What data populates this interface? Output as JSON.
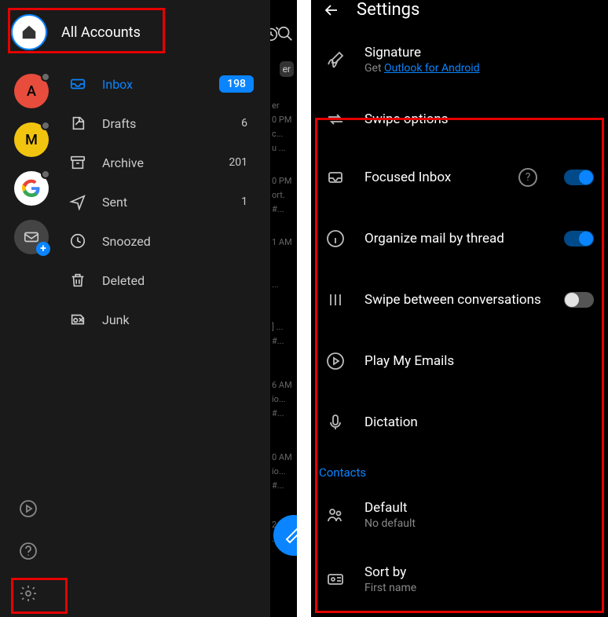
{
  "left": {
    "title": "All Accounts",
    "accounts": [
      {
        "letter": "A",
        "class": "badge-red"
      },
      {
        "letter": "M",
        "class": "badge-yellow"
      },
      {
        "letter": "G",
        "class": "badge-white",
        "google": true
      },
      {
        "letter": "",
        "class": "badge-gray",
        "mail": true,
        "add": true
      }
    ],
    "folders": [
      {
        "name": "Inbox",
        "count": "198",
        "active": true,
        "badge": true,
        "icon": "inbox"
      },
      {
        "name": "Drafts",
        "count": "6",
        "icon": "drafts"
      },
      {
        "name": "Archive",
        "count": "201",
        "icon": "archive"
      },
      {
        "name": "Sent",
        "count": "1",
        "icon": "sent"
      },
      {
        "name": "Snoozed",
        "count": "",
        "icon": "snoozed"
      },
      {
        "name": "Deleted",
        "count": "",
        "icon": "deleted"
      },
      {
        "name": "Junk",
        "count": "",
        "icon": "junk"
      }
    ],
    "peek": {
      "alarm_visible": true,
      "search_visible": true,
      "fragments": [
        "er",
        "0 PM",
        "c...",
        "u ...",
        "0 PM",
        "ort.",
        " #...",
        "1 AM",
        "...",
        "] ...",
        " #...",
        "6 AM",
        "io...",
        " #...",
        "0 AM",
        "io...",
        " #...",
        "2 AM",
        "..."
      ]
    }
  },
  "right": {
    "title": "Settings",
    "signature": {
      "label": "Signature",
      "sub_prefix": "Get ",
      "sub_link": "Outlook for Android"
    },
    "swipe": {
      "label": "Swipe options"
    },
    "items": [
      {
        "label": "Focused Inbox",
        "toggle": "on",
        "help": true,
        "icon": "focused"
      },
      {
        "label": "Organize mail by thread",
        "toggle": "on",
        "icon": "info"
      },
      {
        "label": "Swipe between conversations",
        "toggle": "off",
        "icon": "columns"
      },
      {
        "label": "Play My Emails",
        "icon": "play"
      },
      {
        "label": "Dictation",
        "icon": "mic"
      }
    ],
    "contacts_header": "Contacts",
    "contacts": [
      {
        "label": "Default",
        "sub": "No default",
        "icon": "people"
      },
      {
        "label": "Sort by",
        "sub": "First name",
        "icon": "card"
      }
    ]
  }
}
